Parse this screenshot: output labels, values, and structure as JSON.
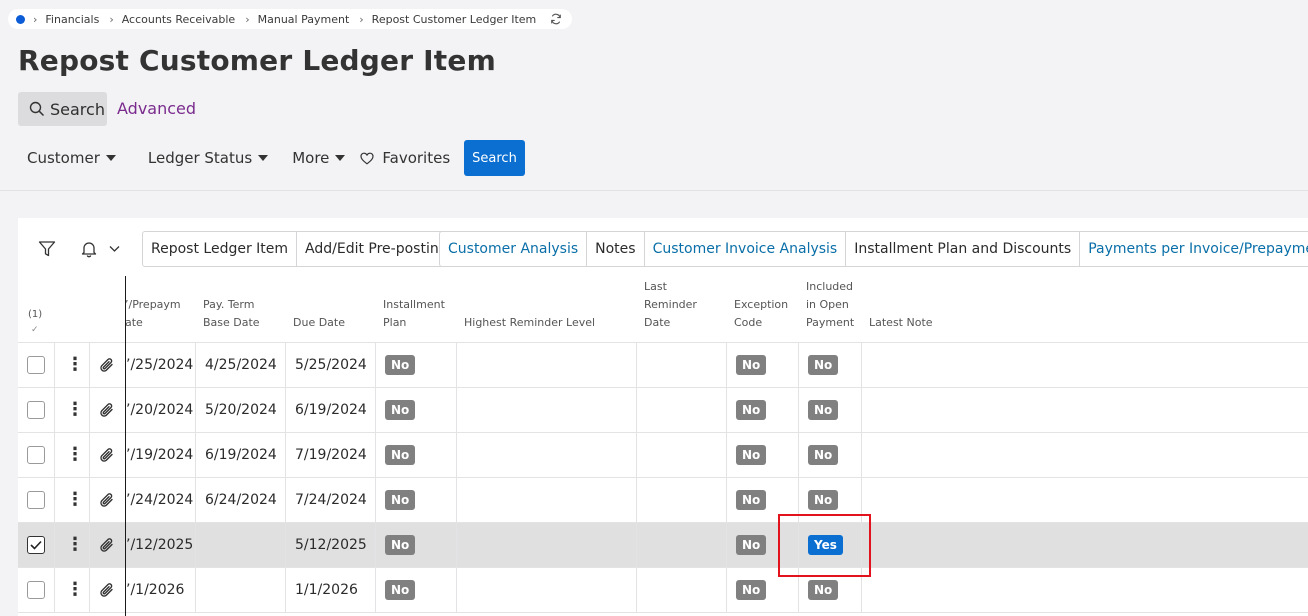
{
  "breadcrumb": {
    "items": [
      "Financials",
      "Accounts Receivable",
      "Manual Payment",
      "Repost Customer Ledger Item"
    ]
  },
  "page_title": "Repost Customer Ledger Item",
  "search_tabs": {
    "search": "Search",
    "advanced": "Advanced"
  },
  "filters": {
    "customer": "Customer",
    "ledger_status": "Ledger Status",
    "more": "More",
    "favorites": "Favorites",
    "search_button": "Search"
  },
  "toolbar": {
    "group1": [
      "Repost Ledger Item",
      "Add/Edit Pre-posting"
    ],
    "group2": [
      "Customer Analysis",
      "Notes",
      "Customer Invoice Analysis",
      "Installment Plan and Discounts",
      "Payments per Invoice/Prepayment"
    ]
  },
  "table": {
    "selected_count": "(1)",
    "columns": {
      "inv_date": [
        "’/Prepaym",
        "ate"
      ],
      "pay_term_base_date": [
        "Pay. Term",
        "Base Date"
      ],
      "due_date": [
        "Due Date"
      ],
      "installment_plan": [
        "Installment",
        "Plan"
      ],
      "highest_reminder_level": [
        "Highest Reminder Level"
      ],
      "last_reminder_date": [
        "Last",
        "Reminder",
        "Date"
      ],
      "exception_code": [
        "Exception",
        "Code"
      ],
      "included_in_open_payment": [
        "Included",
        "in Open",
        "Payment"
      ],
      "latest_note": [
        "Latest Note"
      ]
    },
    "rows": [
      {
        "date": "’/25/2024",
        "base_date": "4/25/2024",
        "due_date": "5/25/2024",
        "installment": "No",
        "exception": "No",
        "included": "No",
        "selected": false
      },
      {
        "date": "’/20/2024",
        "base_date": "5/20/2024",
        "due_date": "6/19/2024",
        "installment": "No",
        "exception": "No",
        "included": "No",
        "selected": false
      },
      {
        "date": "’/19/2024",
        "base_date": "6/19/2024",
        "due_date": "7/19/2024",
        "installment": "No",
        "exception": "No",
        "included": "No",
        "selected": false
      },
      {
        "date": "’/24/2024",
        "base_date": "6/24/2024",
        "due_date": "7/24/2024",
        "installment": "No",
        "exception": "No",
        "included": "No",
        "selected": false
      },
      {
        "date": "’/12/2025",
        "base_date": "",
        "due_date": "5/12/2025",
        "installment": "No",
        "exception": "No",
        "included": "Yes",
        "selected": true
      },
      {
        "date": "’/1/2026",
        "base_date": "",
        "due_date": "1/1/2026",
        "installment": "No",
        "exception": "No",
        "included": "No",
        "selected": false
      }
    ]
  },
  "colors": {
    "accent": "#0a6fd1",
    "badge_no": "#808080",
    "highlight": "#e2131c",
    "link": "#0a6fa8",
    "advanced": "#7a2c8e"
  }
}
